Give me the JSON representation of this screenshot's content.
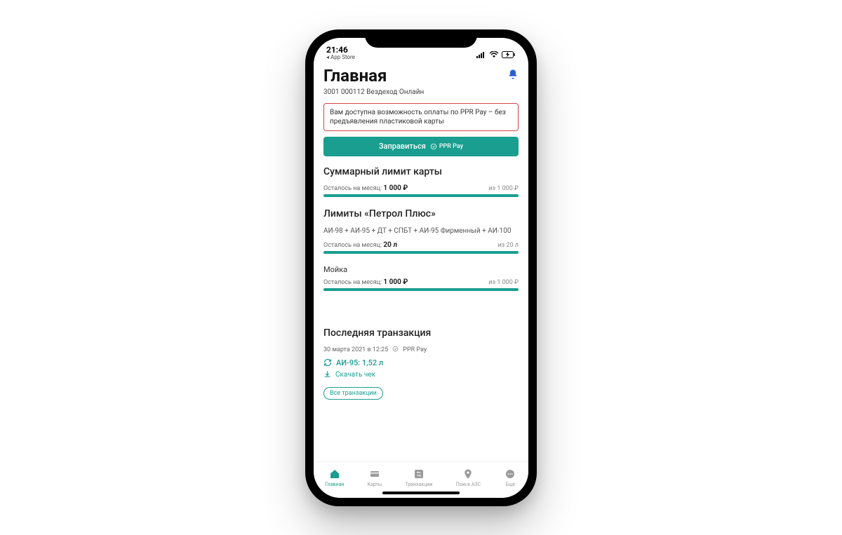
{
  "status": {
    "time": "21:46",
    "back_link": "◂ App Store",
    "signal_icon": "signal",
    "wifi_icon": "wifi",
    "battery_icon": "battery-charging"
  },
  "header": {
    "title": "Главная",
    "subtitle": "3001 000112 Вездеход Онлайн",
    "bell_icon": "bell"
  },
  "promo": {
    "text": "Вам доступна возможность оплаты по PPR Pay – без предъявления пластиковой карты"
  },
  "cta": {
    "label": "Заправиться",
    "badge": "PPR Pay"
  },
  "summary": {
    "title": "Суммарный лимит карты",
    "left_label": "Осталось на месяц:",
    "value": "1 000 ₽",
    "right": "из 1 000 ₽"
  },
  "petrol": {
    "title": "Лимиты «Петрол Плюс»",
    "fuel_list": "АИ-98 + АИ-95 + ДТ + СПБТ + АИ-95 Фирменный + АИ-100",
    "fuel_left_label": "Осталось на месяц:",
    "fuel_value": "20 л",
    "fuel_right": "из 20 л",
    "wash_title": "Мойка",
    "wash_left_label": "Осталось на месяц:",
    "wash_value": "1 000 ₽",
    "wash_right": "из 1 000 ₽"
  },
  "txn": {
    "title": "Последняя транзакция",
    "date": "30 марта 2021 в 12:25",
    "badge": "PPR Pay",
    "product": "АИ-95: 1,52 л",
    "download": "Скачать чек",
    "all": "Все транзакции"
  },
  "tabs": [
    {
      "label": "Главная",
      "icon": "home",
      "active": true
    },
    {
      "label": "Карты",
      "icon": "card",
      "active": false
    },
    {
      "label": "Транзакции",
      "icon": "swap",
      "active": false
    },
    {
      "label": "Поиск АЗС",
      "icon": "pin",
      "active": false
    },
    {
      "label": "Еще",
      "icon": "more",
      "active": false
    }
  ]
}
